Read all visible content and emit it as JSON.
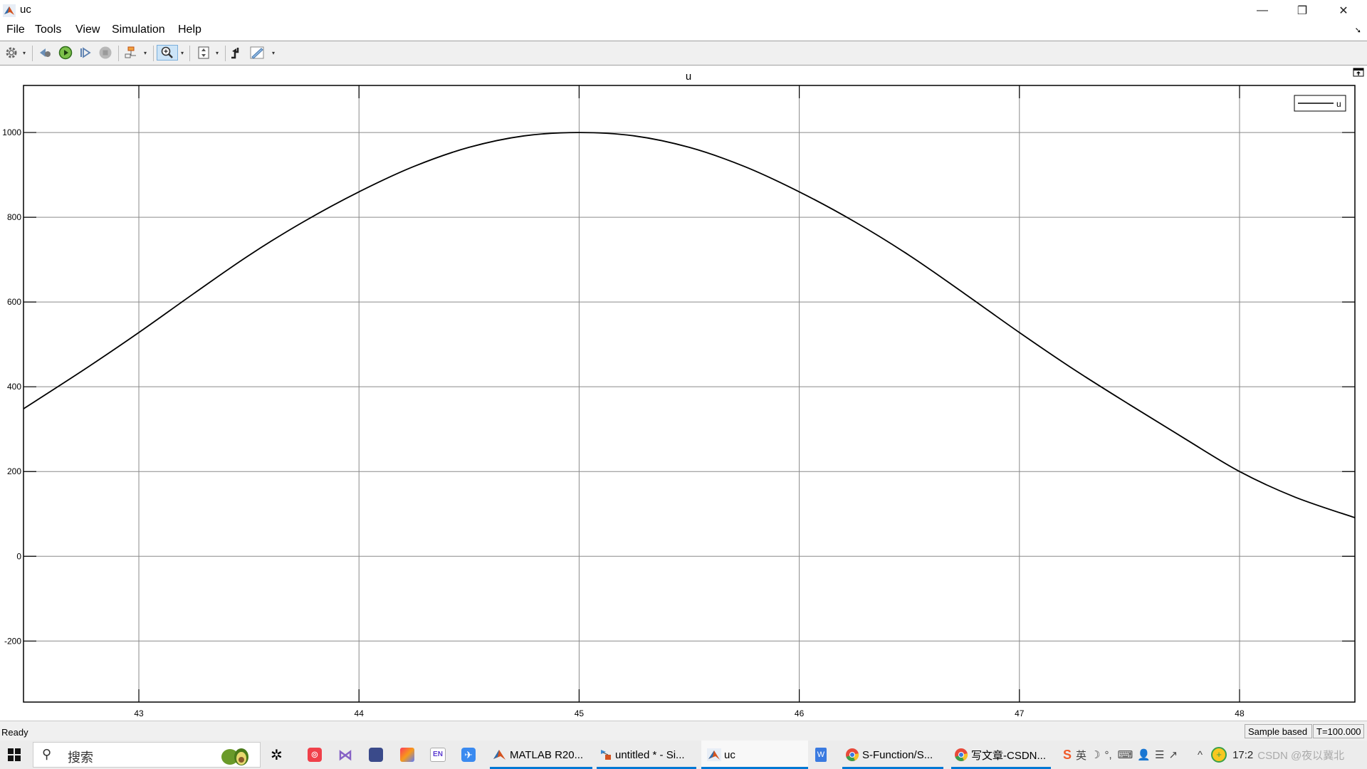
{
  "window": {
    "title": "uc",
    "minimize": "—",
    "restore": "❐",
    "close": "✕"
  },
  "menu": [
    "File",
    "Tools",
    "View",
    "Simulation",
    "Help"
  ],
  "toolbar": {
    "buttons": [
      "settings",
      "step-back",
      "run",
      "step-forward",
      "stop",
      "highlight-in-model",
      "zoom",
      "scale-axes",
      "triggers",
      "measurements"
    ]
  },
  "status": {
    "state": "Ready",
    "mode": "Sample based",
    "time": "T=100.000"
  },
  "taskbar": {
    "search_placeholder": "搜索",
    "items": [
      {
        "label": "MATLAB R20...",
        "icon": "matlab-icon"
      },
      {
        "label": "untitled * - Si...",
        "icon": "simulink-icon"
      },
      {
        "label": "uc",
        "icon": "matlab-icon"
      },
      {
        "label": "S-Function/S...",
        "icon": "chrome-icon"
      },
      {
        "label": "写文章-CSDN...",
        "icon": "chrome-icon"
      }
    ],
    "tray": {
      "ime_lang": "英",
      "clock_partial": "17:2",
      "watermark": "CSDN @夜以冀北"
    }
  },
  "chart_data": {
    "type": "line",
    "title": "u",
    "xlabel": "",
    "ylabel": "",
    "xlim": [
      42.476,
      48.524
    ],
    "ylim": [
      -344,
      1111
    ],
    "xticks": [
      43,
      44,
      45,
      46,
      47,
      48
    ],
    "yticks": [
      -200,
      0,
      200,
      400,
      600,
      800,
      1000
    ],
    "grid": true,
    "legend": {
      "entries": [
        "u"
      ],
      "position": "top-right"
    },
    "series": [
      {
        "name": "u",
        "color": "#000000",
        "x": [
          42.476,
          42.75,
          43.0,
          43.25,
          43.5,
          43.75,
          44.0,
          44.25,
          44.5,
          44.75,
          45.0,
          45.25,
          45.5,
          45.75,
          46.0,
          46.25,
          46.5,
          46.75,
          47.0,
          47.25,
          47.5,
          47.75,
          48.0,
          48.25,
          48.524
        ],
        "y": [
          348,
          440,
          528,
          620,
          710,
          790,
          860,
          920,
          965,
          992,
          1000,
          992,
          965,
          920,
          860,
          790,
          710,
          620,
          528,
          440,
          358,
          278,
          200,
          140,
          91
        ]
      }
    ]
  }
}
